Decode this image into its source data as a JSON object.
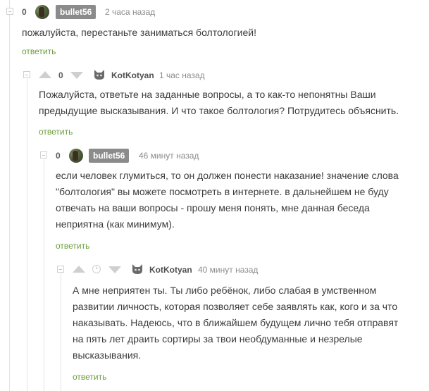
{
  "comments": [
    {
      "rating": "0",
      "username": "bullet56",
      "time": "2 часа назад",
      "text": "пожалуйста, перестаньте заниматься болтологией!",
      "reply": "ответить"
    },
    {
      "rating": "0",
      "username": "KotKotyan",
      "time": "1 час назад",
      "text_lines": [
        "Пожалуйста, ответьте на заданные вопросы, а то как-то непонятны Ваши",
        "предыдущие высказывания. И что такое болтология? Потрудитесь объяснить."
      ],
      "reply": "ответить"
    },
    {
      "rating": "0",
      "username": "bullet56",
      "time": "46 минут назад",
      "text_lines": [
        "если человек глумиться, то он должен понести наказание! значение слова",
        "\"болтология\" вы можете посмотреть в интернете. в дальнейшем не буду",
        "отвечать на ваши вопросы - прошу меня понять, мне данная беседа",
        "неприятна (как минимум)."
      ],
      "reply": "ответить"
    },
    {
      "username": "KotKotyan",
      "time": "40 минут назад",
      "text_lines": [
        "А мне неприятен ты. Ты либо ребёнок, либо слабая в умственном",
        "развитии личность, которая позволяет себе заявлять как, кого и за что",
        "наказывать. Надеюсь, что в ближайшем будущем лично тебя отправят",
        "на пять лет драить сортиры за твои необдуманные и незрелые",
        "высказывания."
      ],
      "reply": "ответить"
    }
  ],
  "icons": {
    "collapse": "collapse-icon",
    "upvote": "arrow-up-icon",
    "downvote": "arrow-down-icon",
    "clock": "clock-icon",
    "avatar_photo": "user-avatar-photo",
    "avatar_cat": "cat-avatar-icon"
  },
  "colors": {
    "reply_link": "#6b9e3c",
    "username_badge": "#8b8b8b",
    "thread_line": "#e3e3e3"
  }
}
